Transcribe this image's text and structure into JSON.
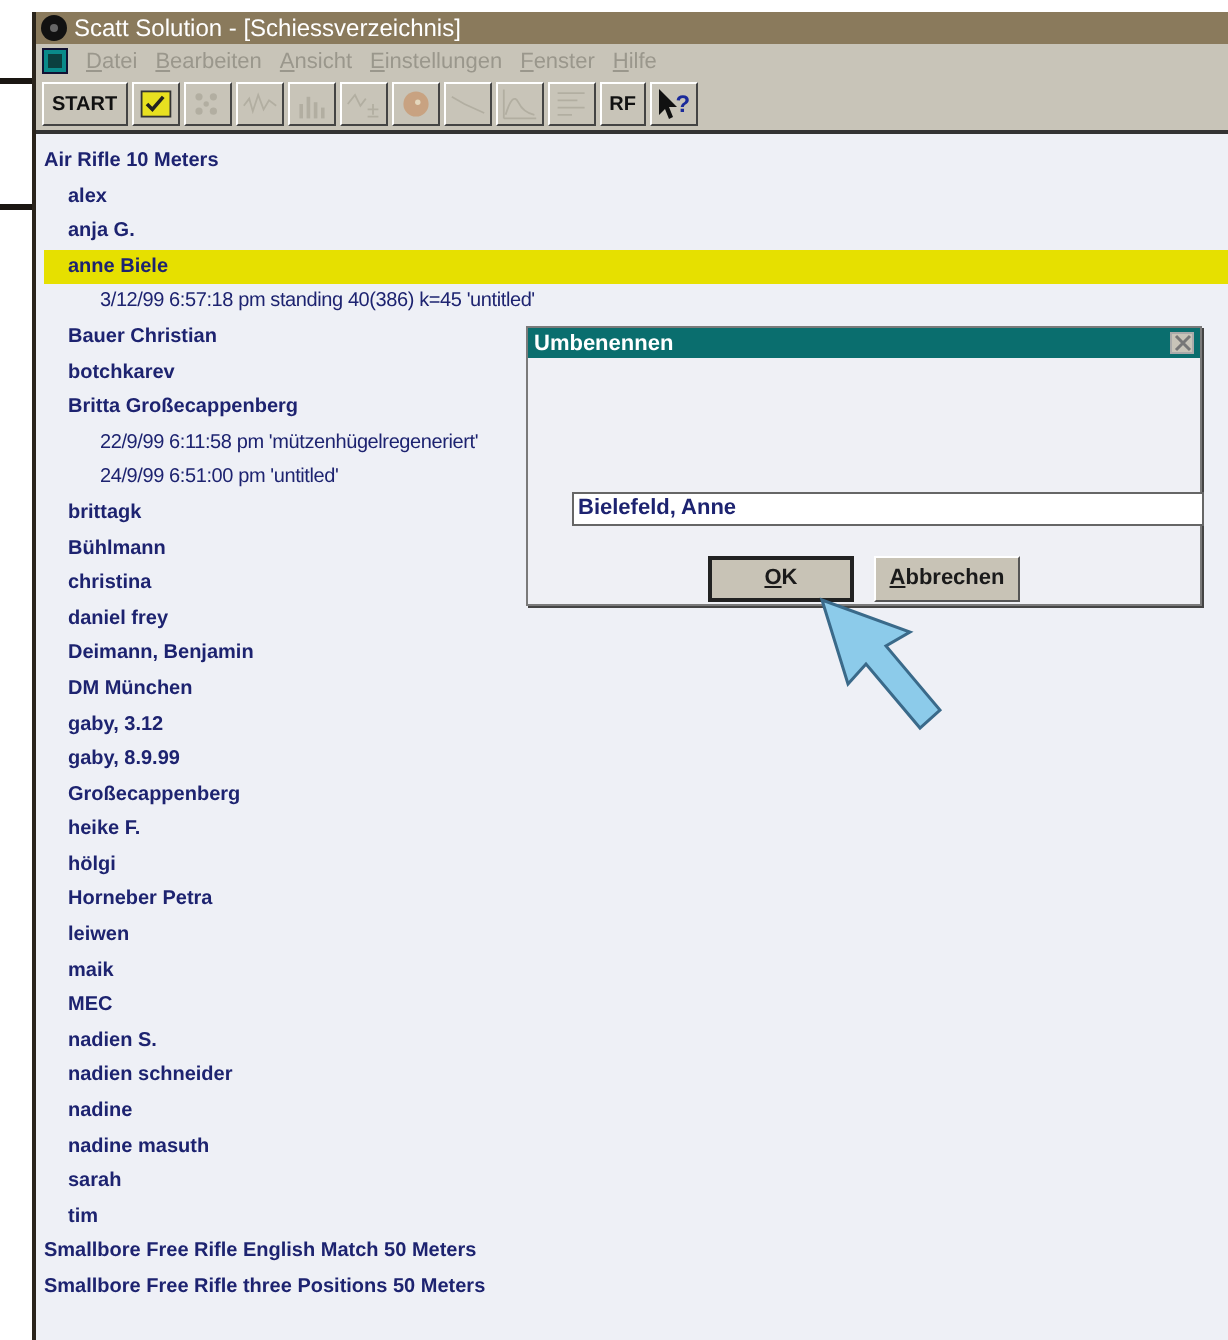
{
  "window": {
    "title": "Scatt Solution - [Schiessverzeichnis]"
  },
  "menu": [
    {
      "label": "Datei",
      "disabled": true
    },
    {
      "label": "Bearbeiten",
      "disabled": true
    },
    {
      "label": "Ansicht",
      "disabled": true
    },
    {
      "label": "Einstellungen",
      "disabled": true
    },
    {
      "label": "Fenster",
      "disabled": true
    },
    {
      "label": "Hilfe",
      "disabled": true
    }
  ],
  "toolbar": [
    {
      "kind": "text",
      "label": "START",
      "disabled": false
    },
    {
      "kind": "checklist",
      "disabled": false
    },
    {
      "kind": "dots",
      "disabled": true
    },
    {
      "kind": "wave",
      "disabled": true
    },
    {
      "kind": "bars",
      "disabled": true
    },
    {
      "kind": "plusminus",
      "disabled": true
    },
    {
      "kind": "target",
      "disabled": true
    },
    {
      "kind": "line",
      "disabled": true
    },
    {
      "kind": "curve",
      "disabled": true
    },
    {
      "kind": "lines",
      "disabled": true
    },
    {
      "kind": "text",
      "label": "RF",
      "disabled": false
    },
    {
      "kind": "help",
      "label": "?",
      "disabled": false
    }
  ],
  "tree": [
    {
      "label": "Air Rifle 10 Meters",
      "children": [
        {
          "label": "alex",
          "selected": false
        },
        {
          "label": "anja G.",
          "selected": false
        },
        {
          "label": "anne Biele",
          "selected": true,
          "children": [
            {
              "label": "3/12/99 6:57:18 pm standing 40(386) k=45 'untitled'"
            }
          ]
        },
        {
          "label": "Bauer Christian",
          "selected": false
        },
        {
          "label": "botchkarev",
          "selected": false
        },
        {
          "label": "Britta Großecappenberg",
          "selected": false,
          "children": [
            {
              "label": "22/9/99 6:11:58 pm 'mützenhügelregeneriert'"
            },
            {
              "label": "24/9/99 6:51:00 pm 'untitled'"
            }
          ]
        },
        {
          "label": "brittagk",
          "selected": false
        },
        {
          "label": "Bühlmann",
          "selected": false
        },
        {
          "label": "christina",
          "selected": false
        },
        {
          "label": "daniel frey",
          "selected": false
        },
        {
          "label": "Deimann, Benjamin",
          "selected": false
        },
        {
          "label": "DM München",
          "selected": false
        },
        {
          "label": "gaby, 3.12",
          "selected": false
        },
        {
          "label": "gaby, 8.9.99",
          "selected": false
        },
        {
          "label": "Großecappenberg",
          "selected": false
        },
        {
          "label": "heike F.",
          "selected": false
        },
        {
          "label": "hölgi",
          "selected": false
        },
        {
          "label": "Horneber Petra",
          "selected": false
        },
        {
          "label": "leiwen",
          "selected": false
        },
        {
          "label": "maik",
          "selected": false
        },
        {
          "label": "MEC",
          "selected": false
        },
        {
          "label": "nadien S.",
          "selected": false
        },
        {
          "label": "nadien schneider",
          "selected": false
        },
        {
          "label": "nadine",
          "selected": false
        },
        {
          "label": "nadine masuth",
          "selected": false
        },
        {
          "label": "sarah",
          "selected": false
        },
        {
          "label": "tim",
          "selected": false
        }
      ]
    },
    {
      "label": "Smallbore Free Rifle English Match 50 Meters"
    },
    {
      "label": "Smallbore Free Rifle three Positions 50 Meters"
    }
  ],
  "dialog": {
    "title": "Umbenennen",
    "value": "Bielefeld, Anne",
    "buttons": [
      {
        "label": "OK",
        "default": true
      },
      {
        "label": "Abbrechen",
        "default": false
      }
    ]
  }
}
